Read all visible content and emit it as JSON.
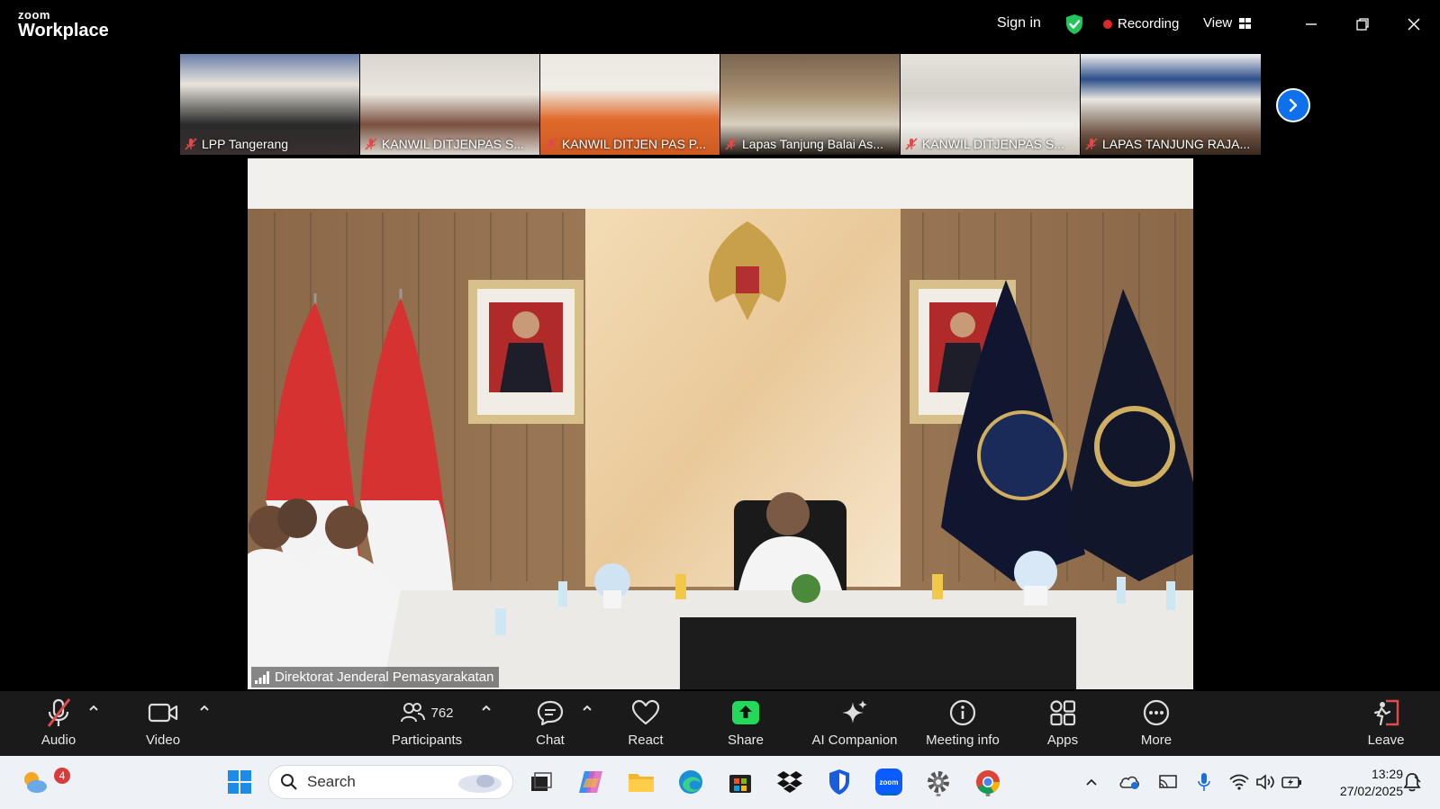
{
  "app": {
    "logo_line1": "zoom",
    "logo_line2": "Workplace"
  },
  "header": {
    "sign_in": "Sign in",
    "recording": "Recording",
    "view": "View"
  },
  "thumbnails": [
    {
      "name": "LPP Tangerang"
    },
    {
      "name": "KANWIL DITJENPAS S..."
    },
    {
      "name": "KANWIL DITJEN PAS P..."
    },
    {
      "name": "Lapas Tanjung Balai As..."
    },
    {
      "name": "KANWIL DITJENPAS S..."
    },
    {
      "name": "LAPAS TANJUNG RAJA..."
    }
  ],
  "main_video": {
    "speaker": "Direktorat Jenderal Pemasyarakatan"
  },
  "toolbar": {
    "audio": "Audio",
    "video": "Video",
    "participants": "Participants",
    "participants_count": "762",
    "chat": "Chat",
    "react": "React",
    "share": "Share",
    "ai_companion": "AI Companion",
    "meeting_info": "Meeting info",
    "apps": "Apps",
    "more": "More",
    "leave": "Leave"
  },
  "taskbar": {
    "search_placeholder": "Search",
    "widgets_badge": "4",
    "time": "13:29",
    "date": "27/02/2025"
  },
  "colors": {
    "accent": "#0e71eb",
    "share_green": "#23d959",
    "record_red": "#e02828",
    "leave_red": "#e04a4a"
  }
}
